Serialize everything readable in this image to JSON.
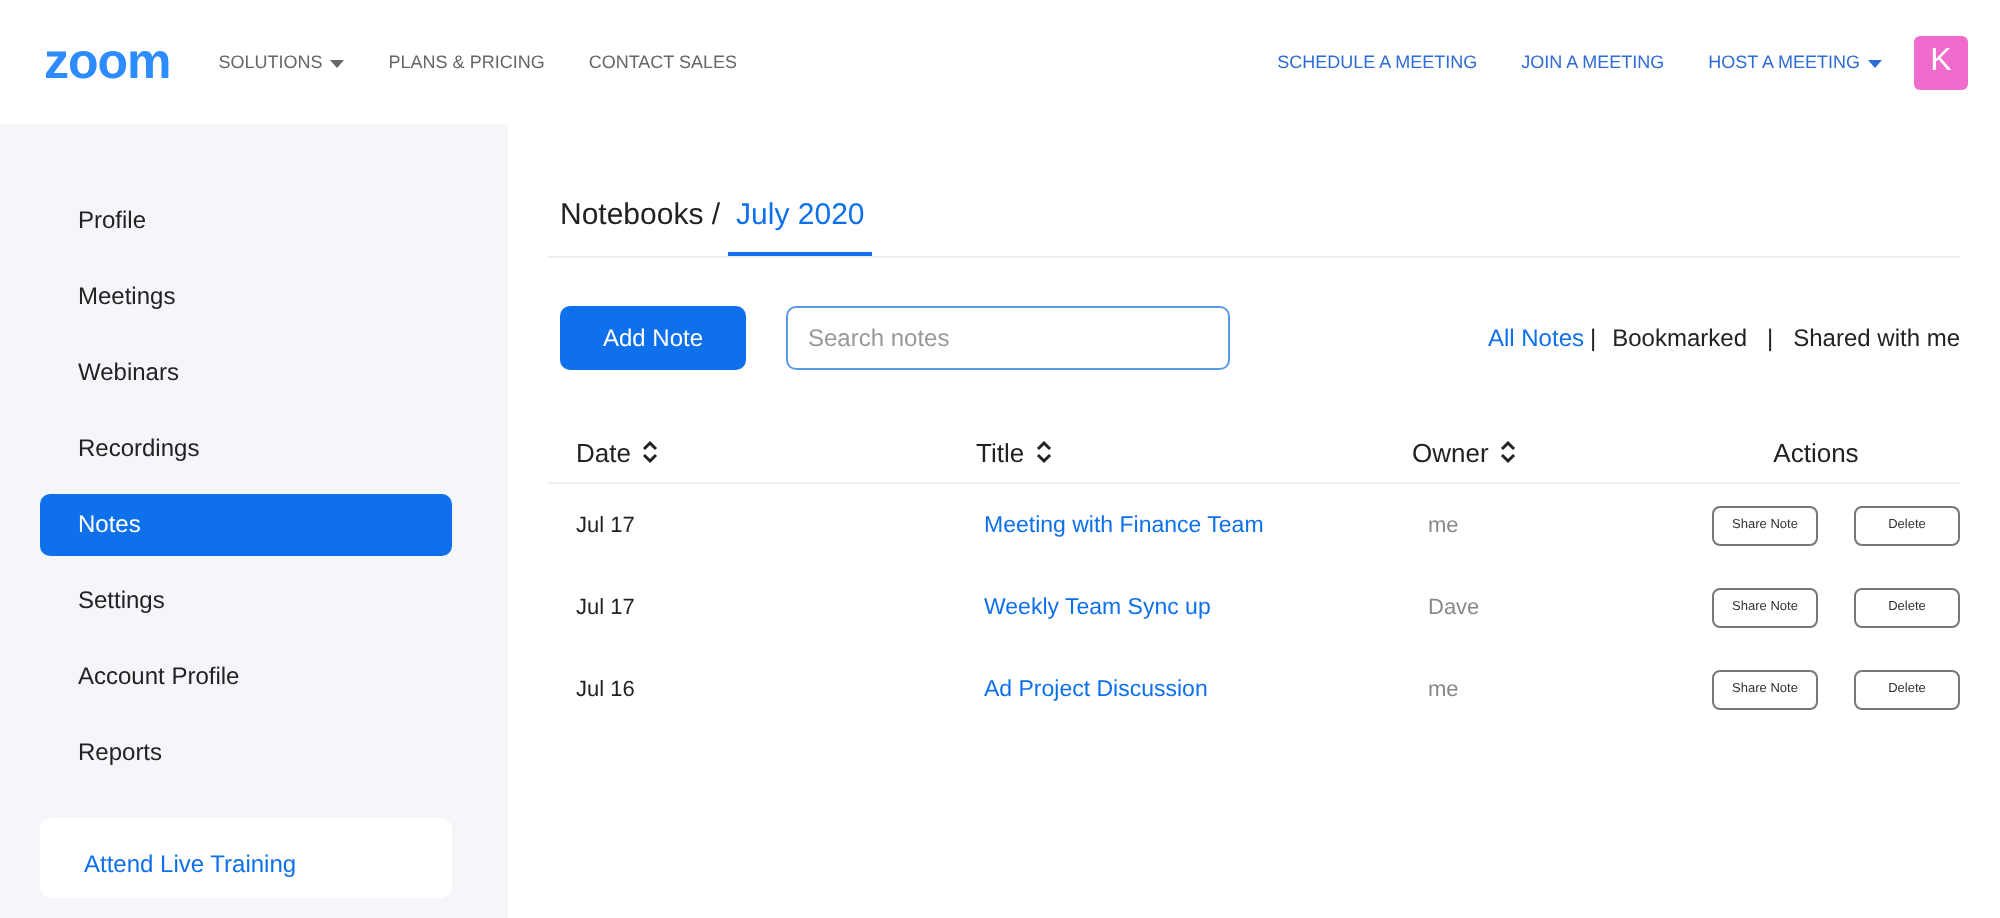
{
  "header": {
    "logo": "zoom",
    "nav_left": [
      {
        "label": "SOLUTIONS",
        "dropdown": true
      },
      {
        "label": "PLANS & PRICING",
        "dropdown": false
      },
      {
        "label": "CONTACT SALES",
        "dropdown": false
      }
    ],
    "nav_right": [
      {
        "label": "SCHEDULE A MEETING",
        "dropdown": false
      },
      {
        "label": "JOIN A MEETING",
        "dropdown": false
      },
      {
        "label": "HOST A MEETING",
        "dropdown": true
      }
    ],
    "avatar": "K"
  },
  "sidebar": {
    "items": [
      {
        "label": "Profile",
        "selected": false
      },
      {
        "label": "Meetings",
        "selected": false
      },
      {
        "label": "Webinars",
        "selected": false
      },
      {
        "label": "Recordings",
        "selected": false
      },
      {
        "label": "Notes",
        "selected": true
      },
      {
        "label": "Settings",
        "selected": false
      },
      {
        "label": "Account Profile",
        "selected": false
      },
      {
        "label": "Reports",
        "selected": false
      }
    ],
    "training_link": "Attend Live Training"
  },
  "breadcrumb": {
    "parent": "Notebooks /",
    "current": "July 2020"
  },
  "toolbar": {
    "add_button": "Add Note",
    "search": {
      "placeholder": "Search notes"
    },
    "filters": [
      {
        "label": "All Notes",
        "selected": true,
        "separator": "|"
      },
      {
        "label": "Bookmarked",
        "selected": false,
        "separator": "|"
      },
      {
        "label": "Shared with me",
        "selected": false
      }
    ]
  },
  "table": {
    "columns": [
      {
        "label": "Date",
        "sortable": true
      },
      {
        "label": "Title",
        "sortable": true
      },
      {
        "label": "Owner",
        "sortable": true
      },
      {
        "label": "Actions",
        "sortable": false
      }
    ],
    "rows": [
      {
        "date": "Jul 17",
        "title": "Meeting with Finance Team",
        "owner": "me",
        "actions": [
          "Share Note",
          "Delete"
        ]
      },
      {
        "date": "Jul 17",
        "title": "Weekly Team Sync up",
        "owner": "Dave",
        "actions": [
          "Share Note",
          "Delete"
        ]
      },
      {
        "date": "Jul 16",
        "title": "Ad Project Discussion",
        "owner": "me",
        "actions": [
          "Share Note",
          "Delete"
        ]
      }
    ]
  }
}
